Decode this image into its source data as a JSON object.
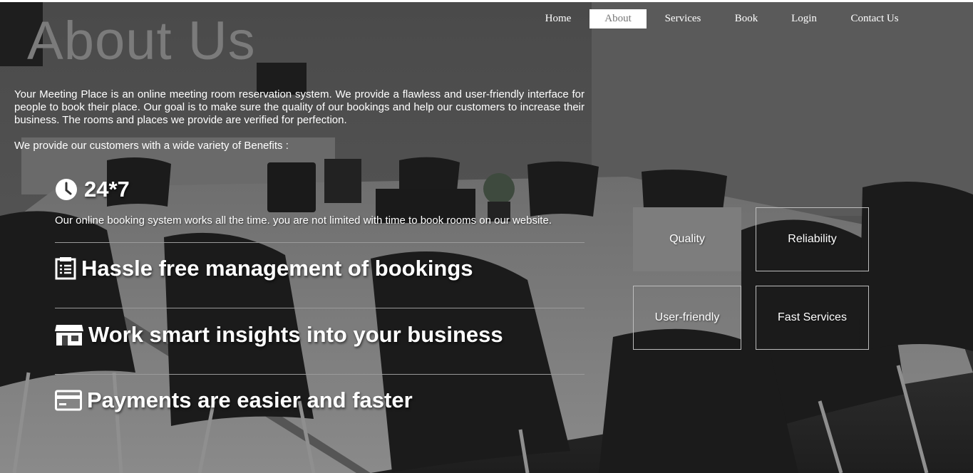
{
  "nav": {
    "items": [
      {
        "label": "Home"
      },
      {
        "label": "About",
        "active": true
      },
      {
        "label": "Services"
      },
      {
        "label": "Book"
      },
      {
        "label": "Login"
      },
      {
        "label": "Contact Us"
      }
    ]
  },
  "page": {
    "title": "About Us",
    "intro": "Your Meeting Place is an online meeting room reservation system. We provide a flawless and user-friendly interface for people to book their place. Our goal is to make sure the quality of our bookings and help our customers to increase their business. The rooms and places we provide are verified for perfection.",
    "benefits_intro": "We provide our customers with a wide variety of Benefits :"
  },
  "features": [
    {
      "title": "24*7",
      "icon": "clock-icon",
      "description": "Our online booking system works all the time. you are not limited with time to book rooms on our website."
    },
    {
      "title": "Hassle free management of bookings",
      "icon": "checklist-icon"
    },
    {
      "title": "Work smart insights into your business",
      "icon": "store-icon"
    },
    {
      "title": "Payments are easier and faster",
      "icon": "credit-card-icon"
    }
  ],
  "tiles": [
    {
      "label": "Quality",
      "highlighted": true
    },
    {
      "label": "Reliability"
    },
    {
      "label": "User-friendly"
    },
    {
      "label": "Fast Services"
    }
  ],
  "colors": {
    "title_gray": "#7b7b7b",
    "active_nav_bg": "#ffffff",
    "active_nav_text": "#777777",
    "highlight_tile": "#7d7d7d"
  }
}
